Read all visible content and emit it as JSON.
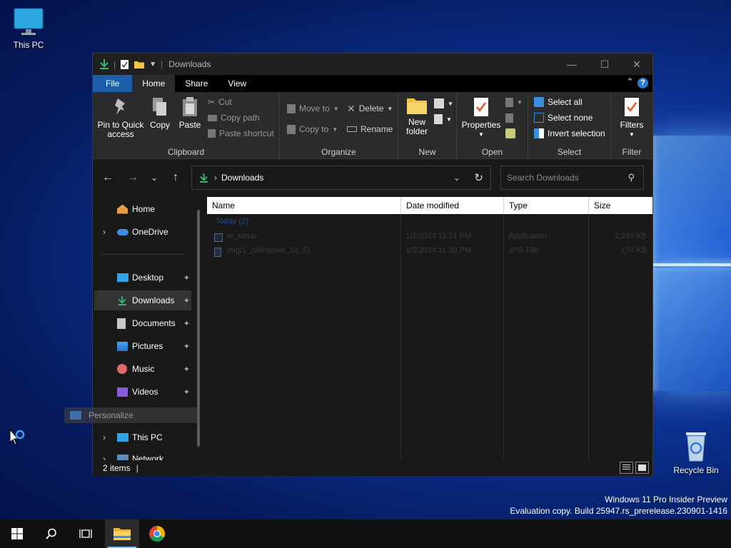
{
  "desktop": {
    "icons": [
      {
        "label": "This PC",
        "icon": "monitor-icon"
      },
      {
        "label": "Recycle Bin",
        "icon": "recycle-bin-icon"
      }
    ],
    "watermark": {
      "line1": "Windows 11 Pro Insider Preview",
      "line2": "Evaluation copy. Build 25947.rs_prerelease.230901-1416"
    },
    "drag_ghost": "Personalize"
  },
  "window": {
    "title": "Downloads",
    "ribbon_tabs": [
      "File",
      "Home",
      "Share",
      "View"
    ],
    "selected_tab": "Home",
    "groups": {
      "clipboard": {
        "label": "Clipboard",
        "pin": "Pin to Quick\naccess",
        "pin_line1": "Pin to Quick",
        "pin_line2": "access",
        "copy": "Copy",
        "paste": "Paste",
        "cut": "Cut",
        "copy_path": "Copy path",
        "paste_shortcut": "Paste shortcut"
      },
      "organize": {
        "label": "Organize",
        "move_to": "Move to",
        "copy_to": "Copy to",
        "delete": "Delete",
        "rename": "Rename"
      },
      "new": {
        "label": "New",
        "new_folder_line1": "New",
        "new_folder_line2": "folder"
      },
      "open": {
        "label": "Open",
        "properties": "Properties"
      },
      "select": {
        "label": "Select",
        "select_all": "Select all",
        "select_none": "Select none",
        "invert": "Invert selection"
      },
      "filter": {
        "label": "Filter",
        "filters": "Filters"
      }
    },
    "address": {
      "path": "Downloads",
      "search_placeholder": "Search Downloads"
    },
    "nav": {
      "home": "Home",
      "onedrive": "OneDrive",
      "desktop": "Desktop",
      "downloads": "Downloads",
      "documents": "Documents",
      "pictures": "Pictures",
      "music": "Music",
      "videos": "Videos",
      "this_pc": "This PC",
      "network": "Network"
    },
    "columns": [
      "Name",
      "Date modified",
      "Type",
      "Size"
    ],
    "group_header": "Today (2)",
    "files": [
      {
        "name": "ie_setup",
        "date": "1/3/2024 11:21 PM",
        "type": "Application",
        "size": "2,297 KB"
      },
      {
        "name": "img/1_(Windows_10_S)",
        "date": "1/3/2024 11:20 PM",
        "type": "JPG File",
        "size": "174 KB"
      }
    ],
    "status": "2 items"
  },
  "colors": {
    "file_tab": "#1c5fa8",
    "accent": "#76b9ed",
    "ribbon_bg": "#2b2b2b"
  }
}
